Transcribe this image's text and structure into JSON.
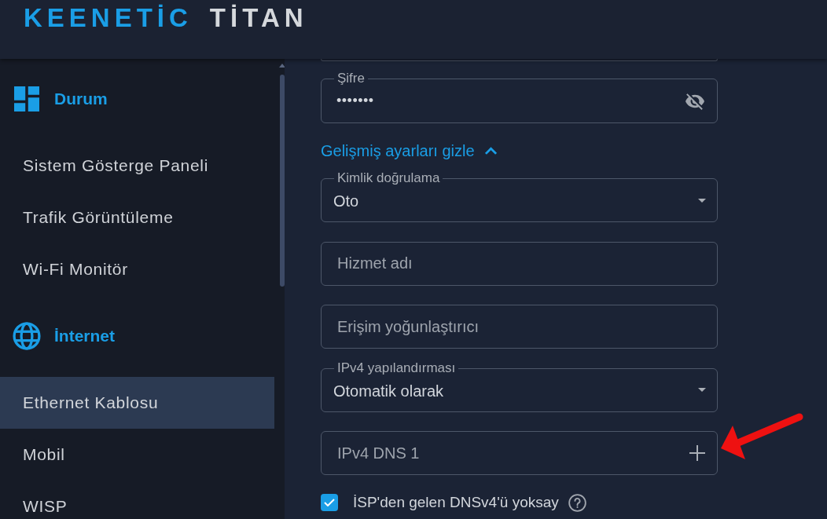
{
  "header": {
    "logo": {
      "brand": "KEENETİC",
      "model": "TİTAN"
    }
  },
  "sidebar": {
    "sections": [
      {
        "title": "Durum",
        "items": [
          {
            "label": "Sistem Gösterge Paneli",
            "selected": false
          },
          {
            "label": "Trafik Görüntüleme",
            "selected": false
          },
          {
            "label": "Wi-Fi Monitör",
            "selected": false
          }
        ]
      },
      {
        "title": "İnternet",
        "items": [
          {
            "label": "Ethernet Kablosu",
            "selected": true
          },
          {
            "label": "Mobil",
            "selected": false
          },
          {
            "label": "WISP",
            "selected": false
          }
        ]
      }
    ]
  },
  "form": {
    "items": [
      {
        "kind": "clipped"
      },
      {
        "kind": "password",
        "label": "Şifre",
        "value": "•••••••"
      },
      {
        "kind": "toggle",
        "label": "Gelişmiş ayarları gizle",
        "expanded": true
      },
      {
        "kind": "select",
        "label": "Kimlik doğrulama",
        "value": "Oto"
      },
      {
        "kind": "text",
        "placeholder": "Hizmet adı"
      },
      {
        "kind": "text",
        "placeholder": "Erişim yoğunlaştırıcı"
      },
      {
        "kind": "select",
        "label": "IPv4 yapılandırması",
        "value": "Otomatik olarak"
      },
      {
        "kind": "add",
        "placeholder": "IPv4 DNS 1"
      },
      {
        "kind": "checkbox",
        "label": "İSP'den gelen DNSv4'ü yoksay",
        "checked": true
      }
    ]
  }
}
